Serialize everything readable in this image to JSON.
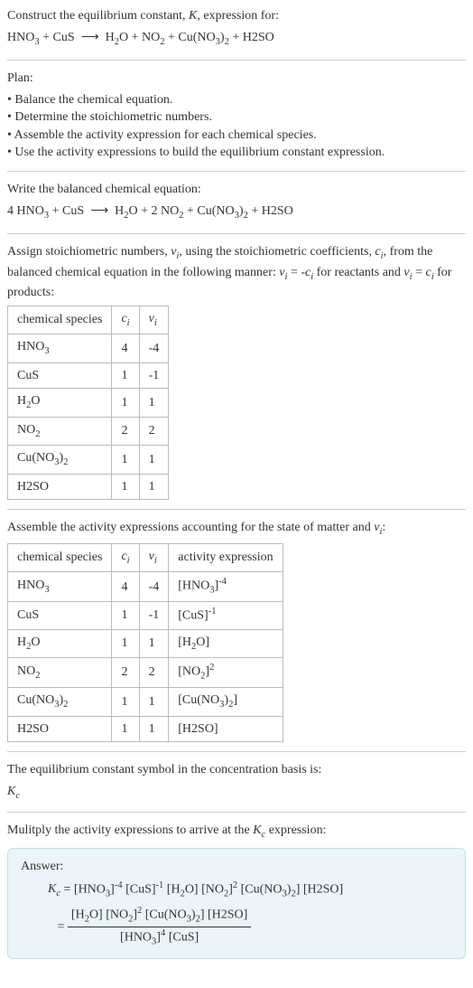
{
  "section1": {
    "heading_a": "Construct the equilibrium constant, ",
    "heading_b": "K",
    "heading_c": ", expression for:"
  },
  "section2": {
    "heading": "Plan:",
    "b1": "• Balance the chemical equation.",
    "b2": "• Determine the stoichiometric numbers.",
    "b3": "• Assemble the activity expression for each chemical species.",
    "b4": "• Use the activity expressions to build the equilibrium constant expression."
  },
  "section3": {
    "heading": "Write the balanced chemical equation:"
  },
  "section4": {
    "line1a": "Assign stoichiometric numbers, ",
    "line1b": ", using the stoichiometric coefficients, ",
    "line1c": ", from the balanced chemical equation in the following manner: ",
    "line1d": " for reactants and ",
    "line1e": " for products:",
    "t": {
      "h1": "chemical species",
      "h2": "cᵢ",
      "h3": "νᵢ",
      "r1c2": "4",
      "r1c3": "-4",
      "r2c2": "1",
      "r2c3": "-1",
      "r3c2": "1",
      "r3c3": "1",
      "r4c2": "2",
      "r4c3": "2",
      "r5c2": "1",
      "r5c3": "1",
      "r6c2": "1",
      "r6c3": "1"
    }
  },
  "section5": {
    "heading_a": "Assemble the activity expressions accounting for the state of matter and ",
    "heading_b": ":",
    "t": {
      "h1": "chemical species",
      "h2": "cᵢ",
      "h3": "νᵢ",
      "h4": "activity expression",
      "r1c2": "4",
      "r1c3": "-4",
      "r2c2": "1",
      "r2c3": "-1",
      "r3c2": "1",
      "r3c3": "1",
      "r4c2": "2",
      "r4c3": "2",
      "r5c2": "1",
      "r5c3": "1",
      "r6c2": "1",
      "r6c3": "1"
    }
  },
  "section6": {
    "heading": "The equilibrium constant symbol in the concentration basis is:"
  },
  "section7": {
    "heading_a": "Mulitply the activity expressions to arrive at the ",
    "heading_b": " expression:",
    "answer_label": "Answer:"
  },
  "chart_data": {
    "type": "table",
    "title": "Stoichiometric numbers and activity expressions",
    "tables": [
      {
        "columns": [
          "chemical species",
          "c_i",
          "ν_i"
        ],
        "rows": [
          [
            "HNO3",
            4,
            -4
          ],
          [
            "CuS",
            1,
            -1
          ],
          [
            "H2O",
            1,
            1
          ],
          [
            "NO2",
            2,
            2
          ],
          [
            "Cu(NO3)2",
            1,
            1
          ],
          [
            "H2SO",
            1,
            1
          ]
        ]
      },
      {
        "columns": [
          "chemical species",
          "c_i",
          "ν_i",
          "activity expression"
        ],
        "rows": [
          [
            "HNO3",
            4,
            -4,
            "[HNO3]^-4"
          ],
          [
            "CuS",
            1,
            -1,
            "[CuS]^-1"
          ],
          [
            "H2O",
            1,
            1,
            "[H2O]"
          ],
          [
            "NO2",
            2,
            2,
            "[NO2]^2"
          ],
          [
            "Cu(NO3)2",
            1,
            1,
            "[Cu(NO3)2]"
          ],
          [
            "H2SO",
            1,
            1,
            "[H2SO]"
          ]
        ]
      }
    ],
    "unbalanced_equation": "HNO3 + CuS ⟶ H2O + NO2 + Cu(NO3)2 + H2SO",
    "balanced_equation": "4 HNO3 + CuS ⟶ H2O + 2 NO2 + Cu(NO3)2 + H2SO",
    "Kc": "([H2O][NO2]^2[Cu(NO3)2][H2SO]) / ([HNO3]^4 [CuS])"
  }
}
